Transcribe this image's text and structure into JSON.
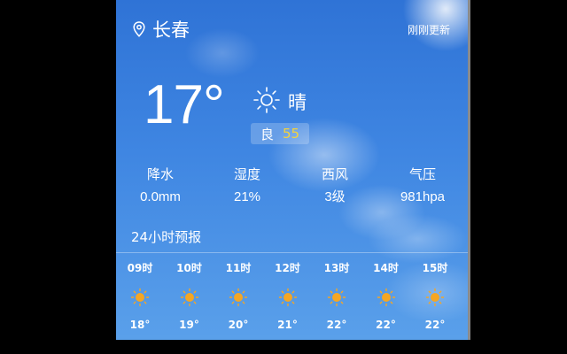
{
  "header": {
    "city": "长春",
    "update_status": "刚刚更新",
    "location_icon": "map-pin-icon"
  },
  "current": {
    "temperature": "17°",
    "condition": "晴",
    "condition_icon": "sun-outline-icon",
    "aqi_label": "良",
    "aqi_value": "55",
    "aqi_color": "#f5d33a"
  },
  "stats": [
    {
      "label": "降水",
      "value": "0.0mm"
    },
    {
      "label": "湿度",
      "value": "21%"
    },
    {
      "label": "西风",
      "value": "3级"
    },
    {
      "label": "气压",
      "value": "981hpa"
    }
  ],
  "forecast": {
    "title": "24小时预报",
    "hours": [
      {
        "time": "09时",
        "temp": "18°",
        "icon": "sun-icon"
      },
      {
        "time": "10时",
        "temp": "19°",
        "icon": "sun-icon"
      },
      {
        "time": "11时",
        "temp": "20°",
        "icon": "sun-icon"
      },
      {
        "time": "12时",
        "temp": "21°",
        "icon": "sun-icon"
      },
      {
        "time": "13时",
        "temp": "22°",
        "icon": "sun-icon"
      },
      {
        "time": "14时",
        "temp": "22°",
        "icon": "sun-icon"
      },
      {
        "time": "15时",
        "temp": "22°",
        "icon": "sun-icon"
      }
    ]
  },
  "colors": {
    "sky_top": "#2f73d6",
    "sky_bottom": "#5aa0ea",
    "sun_icon": "#f5a623"
  }
}
